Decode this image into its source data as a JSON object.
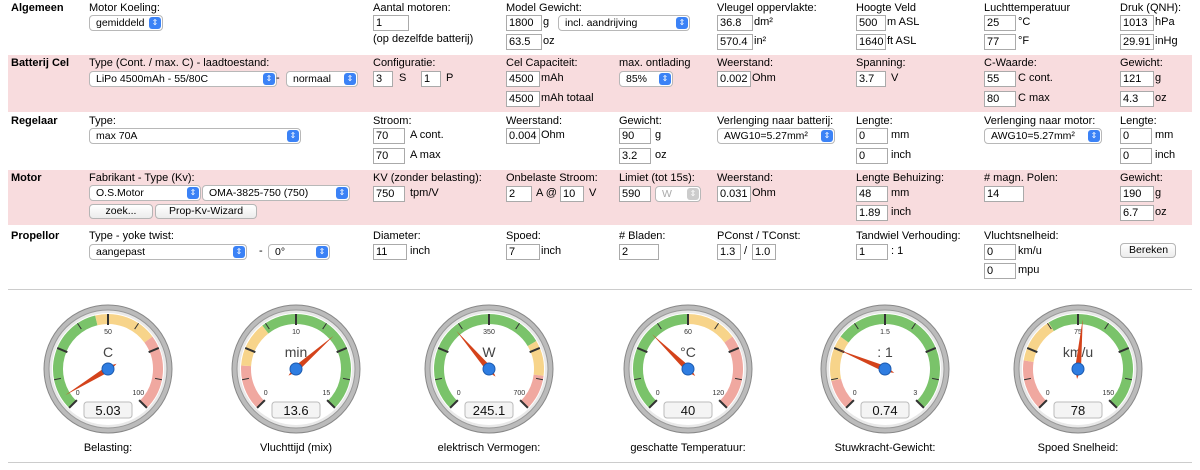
{
  "sections": {
    "algemeen": {
      "title": "Algemeen",
      "motor_koeling": {
        "label": "Motor Koeling:",
        "value": "gemiddeld"
      },
      "aantal_motoren": {
        "label": "Aantal motoren:",
        "value": "1",
        "note": "(op dezelfde batterij)"
      },
      "model_gewicht": {
        "label": "Model Gewicht:",
        "grams": "1800",
        "grams_unit": "g",
        "mode": "incl. aandrijving",
        "oz": "63.5",
        "oz_unit": "oz"
      },
      "vleugel": {
        "label": "Vleugel oppervlakte:",
        "dm2": "36.8",
        "dm2_unit": "dm²",
        "in2": "570.4",
        "in2_unit": "in²"
      },
      "hoogte": {
        "label": "Hoogte Veld",
        "m": "500",
        "m_unit": "m ASL",
        "ft": "1640",
        "ft_unit": "ft ASL"
      },
      "lucht": {
        "label": "Luchttemperatuur",
        "c": "25",
        "c_unit": "°C",
        "f": "77",
        "f_unit": "°F"
      },
      "druk": {
        "label": "Druk (QNH):",
        "hpa": "1013",
        "hpa_unit": "hPa",
        "inhg": "29.91",
        "inhg_unit": "inHg"
      }
    },
    "batterij": {
      "title": "Batterij Cel",
      "type": {
        "label": "Type (Cont. / max. C) - laadtoestand:",
        "value": "LiPo 4500mAh - 55/80C",
        "dash": "-",
        "state": "normaal"
      },
      "config": {
        "label": "Configuratie:",
        "s": "3",
        "s_unit": "S",
        "p": "1",
        "p_unit": "P"
      },
      "capaciteit": {
        "label": "Cel Capaciteit:",
        "mah": "4500",
        "mah_unit": "mAh",
        "total": "4500",
        "total_unit": "mAh totaal"
      },
      "ontlading": {
        "label": "max. ontlading",
        "value": "85%"
      },
      "weerstand": {
        "label": "Weerstand:",
        "value": "0.002",
        "unit": "Ohm"
      },
      "spanning": {
        "label": "Spanning:",
        "value": "3.7",
        "unit": "V"
      },
      "c_waarde": {
        "label": "C-Waarde:",
        "cont": "55",
        "cont_unit": "C cont.",
        "max": "80",
        "max_unit": "C max"
      },
      "gewicht": {
        "label": "Gewicht:",
        "g": "121",
        "g_unit": "g",
        "oz": "4.3",
        "oz_unit": "oz"
      }
    },
    "regelaar": {
      "title": "Regelaar",
      "type": {
        "label": "Type:",
        "value": "max 70A"
      },
      "stroom": {
        "label": "Stroom:",
        "cont": "70",
        "cont_unit": "A cont.",
        "max": "70",
        "max_unit": "A max"
      },
      "weerstand": {
        "label": "Weerstand:",
        "value": "0.004",
        "unit": "Ohm"
      },
      "gewicht": {
        "label": "Gewicht:",
        "g": "90",
        "g_unit": "g",
        "oz": "3.2",
        "oz_unit": "oz"
      },
      "verl_batt": {
        "label": "Verlenging naar batterij:",
        "value": "AWG10=5.27mm²"
      },
      "lengte1": {
        "label": "Lengte:",
        "mm": "0",
        "mm_unit": "mm",
        "inch": "0",
        "inch_unit": "inch"
      },
      "verl_motor": {
        "label": "Verlenging naar motor:",
        "value": "AWG10=5.27mm²"
      },
      "lengte2": {
        "label": "Lengte:",
        "mm": "0",
        "mm_unit": "mm",
        "inch": "0",
        "inch_unit": "inch"
      }
    },
    "motor": {
      "title": "Motor",
      "fabrikant": {
        "label": "Fabrikant - Type (Kv):",
        "maker": "O.S.Motor",
        "type": "OMA-3825-750 (750)",
        "zoek": "zoek...",
        "wizard": "Prop-Kv-Wizard"
      },
      "kv": {
        "label": "KV (zonder belasting):",
        "value": "750",
        "unit": "tpm/V"
      },
      "onbelast": {
        "label": "Onbelaste Stroom:",
        "a": "2",
        "a_unit": "A @",
        "v": "10",
        "v_unit": "V"
      },
      "limiet": {
        "label": "Limiet (tot 15s):",
        "value": "590",
        "unit": "W"
      },
      "weerstand": {
        "label": "Weerstand:",
        "value": "0.031",
        "unit": "Ohm"
      },
      "behuizing": {
        "label": "Lengte Behuizing:",
        "mm": "48",
        "mm_unit": "mm",
        "inch": "1.89",
        "inch_unit": "inch"
      },
      "polen": {
        "label": "# magn. Polen:",
        "value": "14"
      },
      "gewicht": {
        "label": "Gewicht:",
        "g": "190",
        "g_unit": "g",
        "oz": "6.7",
        "oz_unit": "oz"
      }
    },
    "propellor": {
      "title": "Propellor",
      "type": {
        "label": "Type - yoke twist:",
        "value": "aangepast",
        "dash": "-",
        "twist": "0°"
      },
      "diameter": {
        "label": "Diameter:",
        "value": "11",
        "unit": "inch"
      },
      "spoed": {
        "label": "Spoed:",
        "value": "7",
        "unit": "inch"
      },
      "bladen": {
        "label": "# Bladen:",
        "value": "2"
      },
      "pconst": {
        "label": "PConst / TConst:",
        "p": "1.3",
        "sep": "/",
        "t": "1.0"
      },
      "tandwiel": {
        "label": "Tandwiel Verhouding:",
        "value": "1",
        "unit": ": 1"
      },
      "vlucht": {
        "label": "Vluchtsnelheid:",
        "kmh": "0",
        "kmh_unit": "km/u",
        "mph": "0",
        "mph_unit": "mpu"
      },
      "bereken": "Bereken"
    }
  },
  "gauges": [
    {
      "caption": "Belasting:",
      "unit": "C",
      "value": "5.03",
      "min": "0",
      "mid": "50",
      "max": "100",
      "fraction": 0.05,
      "zones": [
        [
          "#7ac36a",
          0,
          0.45
        ],
        [
          "#f7d48a",
          0.45,
          0.7
        ],
        [
          "#f0a8a0",
          0.7,
          1
        ]
      ]
    },
    {
      "caption": "Vluchttijd (mix)",
      "unit": "min",
      "value": "13.6",
      "min": "0",
      "mid": "10",
      "max": "15",
      "fraction": 0.68,
      "zones": [
        [
          "#f0a8a0",
          0,
          0.18
        ],
        [
          "#f7d48a",
          0.18,
          0.36
        ],
        [
          "#7ac36a",
          0.36,
          1
        ]
      ]
    },
    {
      "caption": "elektrisch Vermogen:",
      "unit": "W",
      "value": "245.1",
      "min": "0",
      "mid": "350",
      "max": "700",
      "fraction": 0.35,
      "zones": [
        [
          "#7ac36a",
          0,
          0.72
        ],
        [
          "#f7d48a",
          0.72,
          0.86
        ],
        [
          "#f0a8a0",
          0.86,
          1
        ]
      ]
    },
    {
      "caption": "geschatte Temperatuur:",
      "unit": "°C",
      "value": "40",
      "min": "0",
      "mid": "60",
      "max": "120",
      "fraction": 0.33,
      "zones": [
        [
          "#7ac36a",
          0,
          0.5
        ],
        [
          "#f7d48a",
          0.5,
          0.7
        ],
        [
          "#f0a8a0",
          0.7,
          1
        ]
      ]
    },
    {
      "caption": "Stuwkracht-Gewicht:",
      "unit": ": 1",
      "value": "0.74",
      "min": "0",
      "mid": "1.5",
      "max": "3",
      "fraction": 0.25,
      "zones": [
        [
          "#f0a8a0",
          0,
          0.12
        ],
        [
          "#f7d48a",
          0.12,
          0.3
        ],
        [
          "#7ac36a",
          0.3,
          1
        ]
      ]
    },
    {
      "caption": "Spoed Snelheid:",
      "unit": "km/u",
      "value": "78",
      "min": "0",
      "mid": "75",
      "max": "150",
      "fraction": 0.52,
      "zones": [
        [
          "#f0a8a0",
          0,
          0.2
        ],
        [
          "#f7d48a",
          0.2,
          0.38
        ],
        [
          "#7ac36a",
          0.38,
          1
        ]
      ]
    }
  ]
}
